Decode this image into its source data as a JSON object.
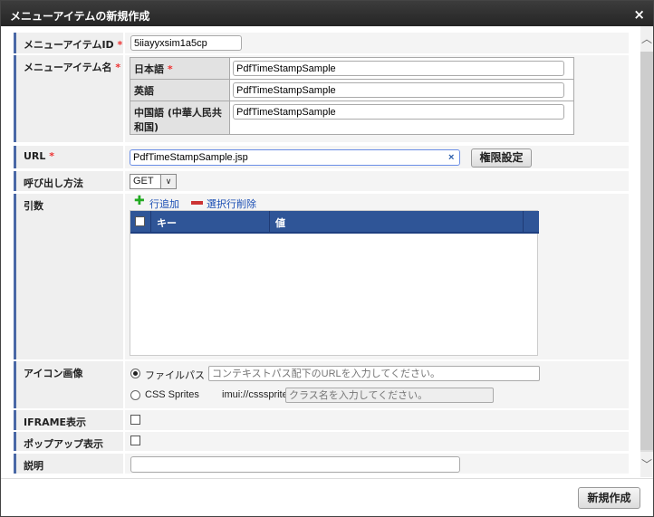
{
  "dialog": {
    "title": "メニューアイテムの新規作成",
    "close": "×"
  },
  "required_mark": "*",
  "fields": {
    "id": {
      "label": "メニューアイテムID",
      "value": "5iiayyxsim1a5cp"
    },
    "name": {
      "label": "メニューアイテム名",
      "langs": [
        {
          "label": "日本語",
          "required": true,
          "value": "PdfTimeStampSample"
        },
        {
          "label": "英語",
          "value": "PdfTimeStampSample"
        },
        {
          "label": "中国語 (中華人民共和国)",
          "value": "PdfTimeStampSample"
        }
      ]
    },
    "url": {
      "label": "URL",
      "value": "PdfTimeStampSample.jsp",
      "clear": "×",
      "auth_button": "権限設定"
    },
    "method": {
      "label": "呼び出し方法",
      "value": "GET",
      "arrow": "∨"
    },
    "args": {
      "label": "引数",
      "add": "行追加",
      "remove": "選択行削除",
      "columns": [
        "キー",
        "値"
      ]
    },
    "icon": {
      "label": "アイコン画像",
      "file_path": "ファイルパス",
      "file_placeholder": "コンテキストパス配下のURLを入力してください。",
      "css_sprites": "CSS Sprites",
      "prefix": "imui://csssprites/",
      "class_placeholder": "クラス名を入力してください。"
    },
    "iframe": {
      "label": "IFRAME表示"
    },
    "popup": {
      "label": "ポップアップ表示"
    },
    "description": {
      "label": "説明",
      "value": ""
    }
  },
  "footer": {
    "create_button": "新規作成"
  }
}
